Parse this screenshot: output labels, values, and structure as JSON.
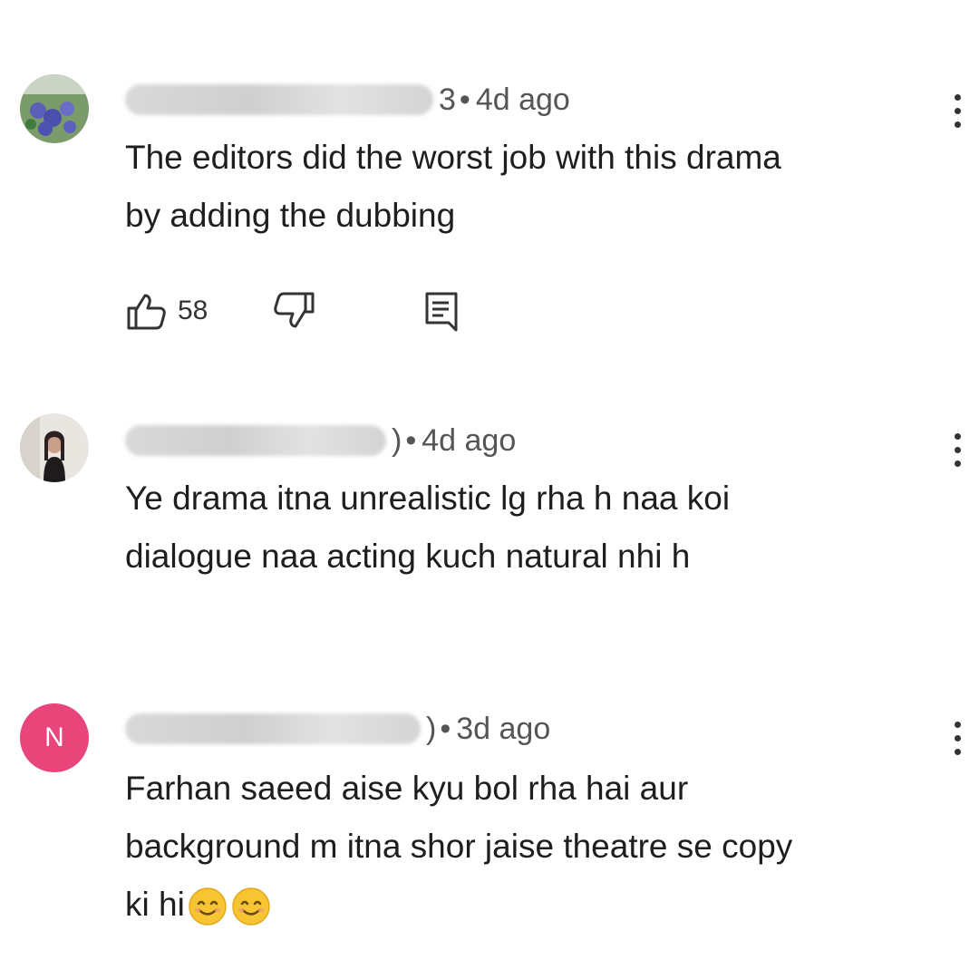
{
  "comments": [
    {
      "author_suffix": "3",
      "separator": "•",
      "time": "4d ago",
      "text_lines": [
        "The editors did the worst job with this drama",
        "by adding the dubbing"
      ],
      "likes": "58",
      "avatar_icon": "flower-photo-avatar"
    },
    {
      "author_suffix": ")",
      "separator": "•",
      "time": "4d ago",
      "text_lines": [
        "Ye drama itna unrealistic lg rha h naa koi",
        "dialogue naa acting kuch natural nhi h"
      ],
      "avatar_icon": "person-photo-avatar"
    },
    {
      "author_suffix": ")",
      "separator": "•",
      "time": "3d ago",
      "text_lines": [
        "Farhan saeed aise kyu bol rha hai aur",
        "background m itna shor jaise theatre se copy",
        "ki hi"
      ],
      "avatar_letter": "N",
      "emojis": [
        "smiling-face-emoji",
        "smiling-face-emoji"
      ]
    }
  ],
  "icons": {
    "like": "thumbs-up-icon",
    "dislike": "thumbs-down-icon",
    "reply": "reply-comment-icon",
    "menu": "more-vertical-icon"
  },
  "colors": {
    "avatar_n": "#e8457a",
    "text": "#1e1e1e",
    "meta": "#555555"
  }
}
